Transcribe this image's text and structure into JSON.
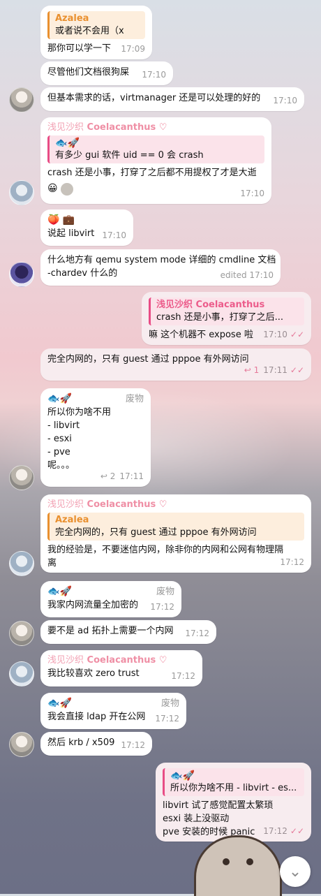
{
  "users": {
    "coelacanthus": {
      "nick": "浅见沙织",
      "name": "Coelacanthus",
      "heart": "♡"
    },
    "rank_label": "废物"
  },
  "quote_names": {
    "azalea": "Azalea",
    "coelacanthus": "浅见沙织 Coelacanthus"
  },
  "icons": {
    "fish": "🐟",
    "rocket": "🚀",
    "peach": "🍑",
    "briefcase": "💼",
    "grin": "😀"
  },
  "messages": [
    {
      "quote_text": "或者说不会用（x",
      "text": "那你可以学一下",
      "time": "17:09"
    },
    {
      "text": "尽管他们文档很狗屎",
      "time": "17:10"
    },
    {
      "text": "但基本需求的话，virtmanager 还是可以处理的好的",
      "time": "17:10"
    },
    {
      "quote_text": "有多少 gui 软件 uid == 0 会 crash",
      "text": "crash 还是小事，打穿了之后都不用提权了才是大逝",
      "time": "17:10"
    },
    {
      "text": "说起 libvirt",
      "time": "17:10"
    },
    {
      "line1": "什么地方有 qemu system mode 详细的 cmdline 文档",
      "line2": "-chardev 什么的",
      "time": "edited 17:10"
    },
    {
      "quote_text": "crash 还是小事，打穿了之后...",
      "text": "嘛 这个机器不 expose 啦",
      "time": "17:10"
    },
    {
      "text": "完全内网的，只有 guest 通过 pppoe 有外网访问",
      "replies": "1",
      "time": "17:11"
    },
    {
      "lines": [
        "所以你为啥不用",
        "- libvirt",
        "- esxi",
        "- pve",
        "呢。。。"
      ],
      "replies": "2",
      "time": "17:11"
    },
    {
      "quote_text": "完全内网的，只有 guest 通过 pppoe 有外网访问",
      "line1": "我的经验是，不要迷信内网，除非你的内网和公网有物理隔",
      "line2": "离",
      "time": "17:12"
    },
    {
      "text": "我家内网流量全加密的",
      "time": "17:12"
    },
    {
      "text": "要不是 ad 拓扑上需要一个内网",
      "time": "17:12"
    },
    {
      "text": "我比较喜欢 zero trust",
      "time": "17:12"
    },
    {
      "text": "我会直接 ldap 开在公网",
      "time": "17:12"
    },
    {
      "text": "然后 krb / x509",
      "time": "17:12"
    },
    {
      "quote_text": "所以你为啥不用 - libvirt - es...",
      "lines": [
        "libvirt 试了感觉配置太繁琐",
        "esxi 装上没驱动",
        "pve 安装的时候 panic"
      ],
      "time": "17:12"
    }
  ],
  "colors": {
    "accent": "#e84c85",
    "sender": "#ef8fa5",
    "outgoing": "#f7ecef"
  }
}
